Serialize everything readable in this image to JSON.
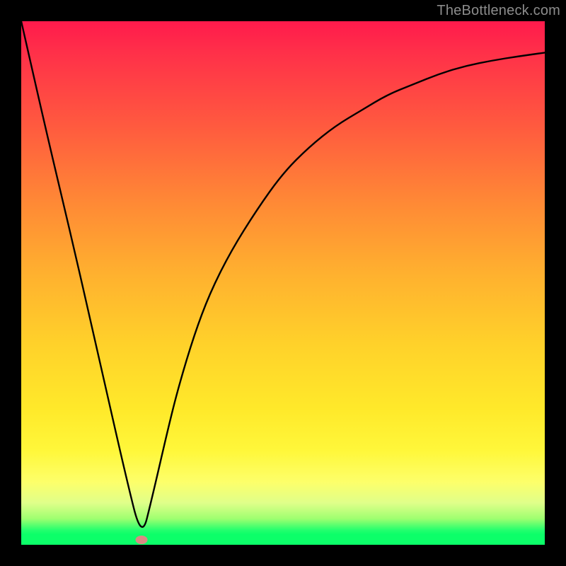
{
  "watermark": "TheBottleneck.com",
  "colors": {
    "frame": "#000000",
    "curve": "#000000",
    "marker": "#da8a84",
    "gradient_top": "#ff1a4c",
    "gradient_bottom": "#0cff69"
  },
  "chart_data": {
    "type": "line",
    "title": "",
    "xlabel": "",
    "ylabel": "",
    "xlim": [
      0,
      100
    ],
    "ylim": [
      0,
      100
    ],
    "annotations": [
      {
        "label": "optimal-point",
        "x": 23,
        "y": 1
      }
    ],
    "series": [
      {
        "name": "bottleneck-curve",
        "x": [
          0,
          5,
          10,
          15,
          20,
          23,
          25,
          28,
          30,
          33,
          36,
          40,
          45,
          50,
          55,
          60,
          65,
          70,
          75,
          80,
          85,
          90,
          95,
          100
        ],
        "y": [
          100,
          78,
          57,
          35,
          13,
          1,
          9,
          22,
          30,
          40,
          48,
          56,
          64,
          71,
          76,
          80,
          83,
          86,
          88,
          90,
          91.5,
          92.5,
          93.3,
          94
        ]
      }
    ]
  }
}
